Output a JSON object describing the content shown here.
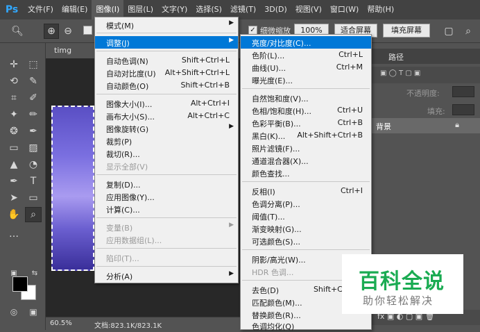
{
  "app": {
    "logo": "Ps"
  },
  "menubar": [
    {
      "label": "文件(F)"
    },
    {
      "label": "编辑(E)"
    },
    {
      "label": "图像(I)"
    },
    {
      "label": "图层(L)"
    },
    {
      "label": "文字(Y)"
    },
    {
      "label": "选择(S)"
    },
    {
      "label": "滤镜(T)"
    },
    {
      "label": "3D(D)"
    },
    {
      "label": "视图(V)"
    },
    {
      "label": "窗口(W)"
    },
    {
      "label": "帮助(H)"
    }
  ],
  "options": {
    "scrubby_zoom_label": "细微缩放",
    "zoom_100_label": "100%",
    "fit_screen_label": "适合屏幕",
    "fill_screen_label": "填充屏幕"
  },
  "document": {
    "tab_label": "timg (1).jpg",
    "zoom": "60.5%",
    "doc_size": "文档:823.1K/823.1K"
  },
  "image_menu": {
    "items": [
      {
        "label": "模式(M)",
        "shortcut": "",
        "submenu": true
      },
      {
        "label": "调整(J)",
        "shortcut": "",
        "submenu": true,
        "highlighted": true
      },
      {
        "label": "自动色调(N)",
        "shortcut": "Shift+Ctrl+L"
      },
      {
        "label": "自动对比度(U)",
        "shortcut": "Alt+Shift+Ctrl+L"
      },
      {
        "label": "自动颜色(O)",
        "shortcut": "Shift+Ctrl+B"
      },
      {
        "label": "图像大小(I)...",
        "shortcut": "Alt+Ctrl+I"
      },
      {
        "label": "画布大小(S)...",
        "shortcut": "Alt+Ctrl+C"
      },
      {
        "label": "图像旋转(G)",
        "shortcut": "",
        "submenu": true
      },
      {
        "label": "裁剪(P)",
        "shortcut": ""
      },
      {
        "label": "裁切(R)...",
        "shortcut": ""
      },
      {
        "label": "显示全部(V)",
        "shortcut": "",
        "disabled": true
      },
      {
        "label": "复制(D)...",
        "shortcut": ""
      },
      {
        "label": "应用图像(Y)...",
        "shortcut": ""
      },
      {
        "label": "计算(C)...",
        "shortcut": ""
      },
      {
        "label": "变量(B)",
        "shortcut": "",
        "submenu": true,
        "disabled": true
      },
      {
        "label": "应用数据组(L)...",
        "shortcut": "",
        "disabled": true
      },
      {
        "label": "陷印(T)...",
        "shortcut": "",
        "disabled": true
      },
      {
        "label": "分析(A)",
        "shortcut": "",
        "submenu": true
      }
    ]
  },
  "adjust_menu": {
    "items": [
      {
        "label": "亮度/对比度(C)...",
        "shortcut": "",
        "highlighted": true
      },
      {
        "label": "色阶(L)...",
        "shortcut": "Ctrl+L"
      },
      {
        "label": "曲线(U)...",
        "shortcut": "Ctrl+M"
      },
      {
        "label": "曝光度(E)...",
        "shortcut": ""
      },
      {
        "label": "自然饱和度(V)...",
        "shortcut": ""
      },
      {
        "label": "色相/饱和度(H)...",
        "shortcut": "Ctrl+U"
      },
      {
        "label": "色彩平衡(B)...",
        "shortcut": "Ctrl+B"
      },
      {
        "label": "黑白(K)...",
        "shortcut": "Alt+Shift+Ctrl+B"
      },
      {
        "label": "照片滤镜(F)...",
        "shortcut": ""
      },
      {
        "label": "通道混合器(X)...",
        "shortcut": ""
      },
      {
        "label": "颜色查找...",
        "shortcut": ""
      },
      {
        "label": "反相(I)",
        "shortcut": "Ctrl+I"
      },
      {
        "label": "色调分离(P)...",
        "shortcut": ""
      },
      {
        "label": "阈值(T)...",
        "shortcut": ""
      },
      {
        "label": "渐变映射(G)...",
        "shortcut": ""
      },
      {
        "label": "可选颜色(S)...",
        "shortcut": ""
      },
      {
        "label": "阴影/高光(W)...",
        "shortcut": ""
      },
      {
        "label": "HDR 色调...",
        "shortcut": "",
        "disabled": true
      },
      {
        "label": "去色(D)",
        "shortcut": "Shift+Ctrl+U"
      },
      {
        "label": "匹配颜色(M)...",
        "shortcut": ""
      },
      {
        "label": "替换颜色(R)...",
        "shortcut": ""
      },
      {
        "label": "色调均化(Q)",
        "shortcut": ""
      }
    ]
  },
  "panels": {
    "paths_tab": "路径",
    "opacity_label": "不透明度:",
    "fill_label": "填充:",
    "background_layer": "背景"
  },
  "watermark": {
    "title": "百科全说",
    "subtitle": "助你轻松解决"
  },
  "colors": {
    "menubar_bg": "#424242",
    "highlight": "#0078d7",
    "watermark_green": "#1aab52"
  }
}
